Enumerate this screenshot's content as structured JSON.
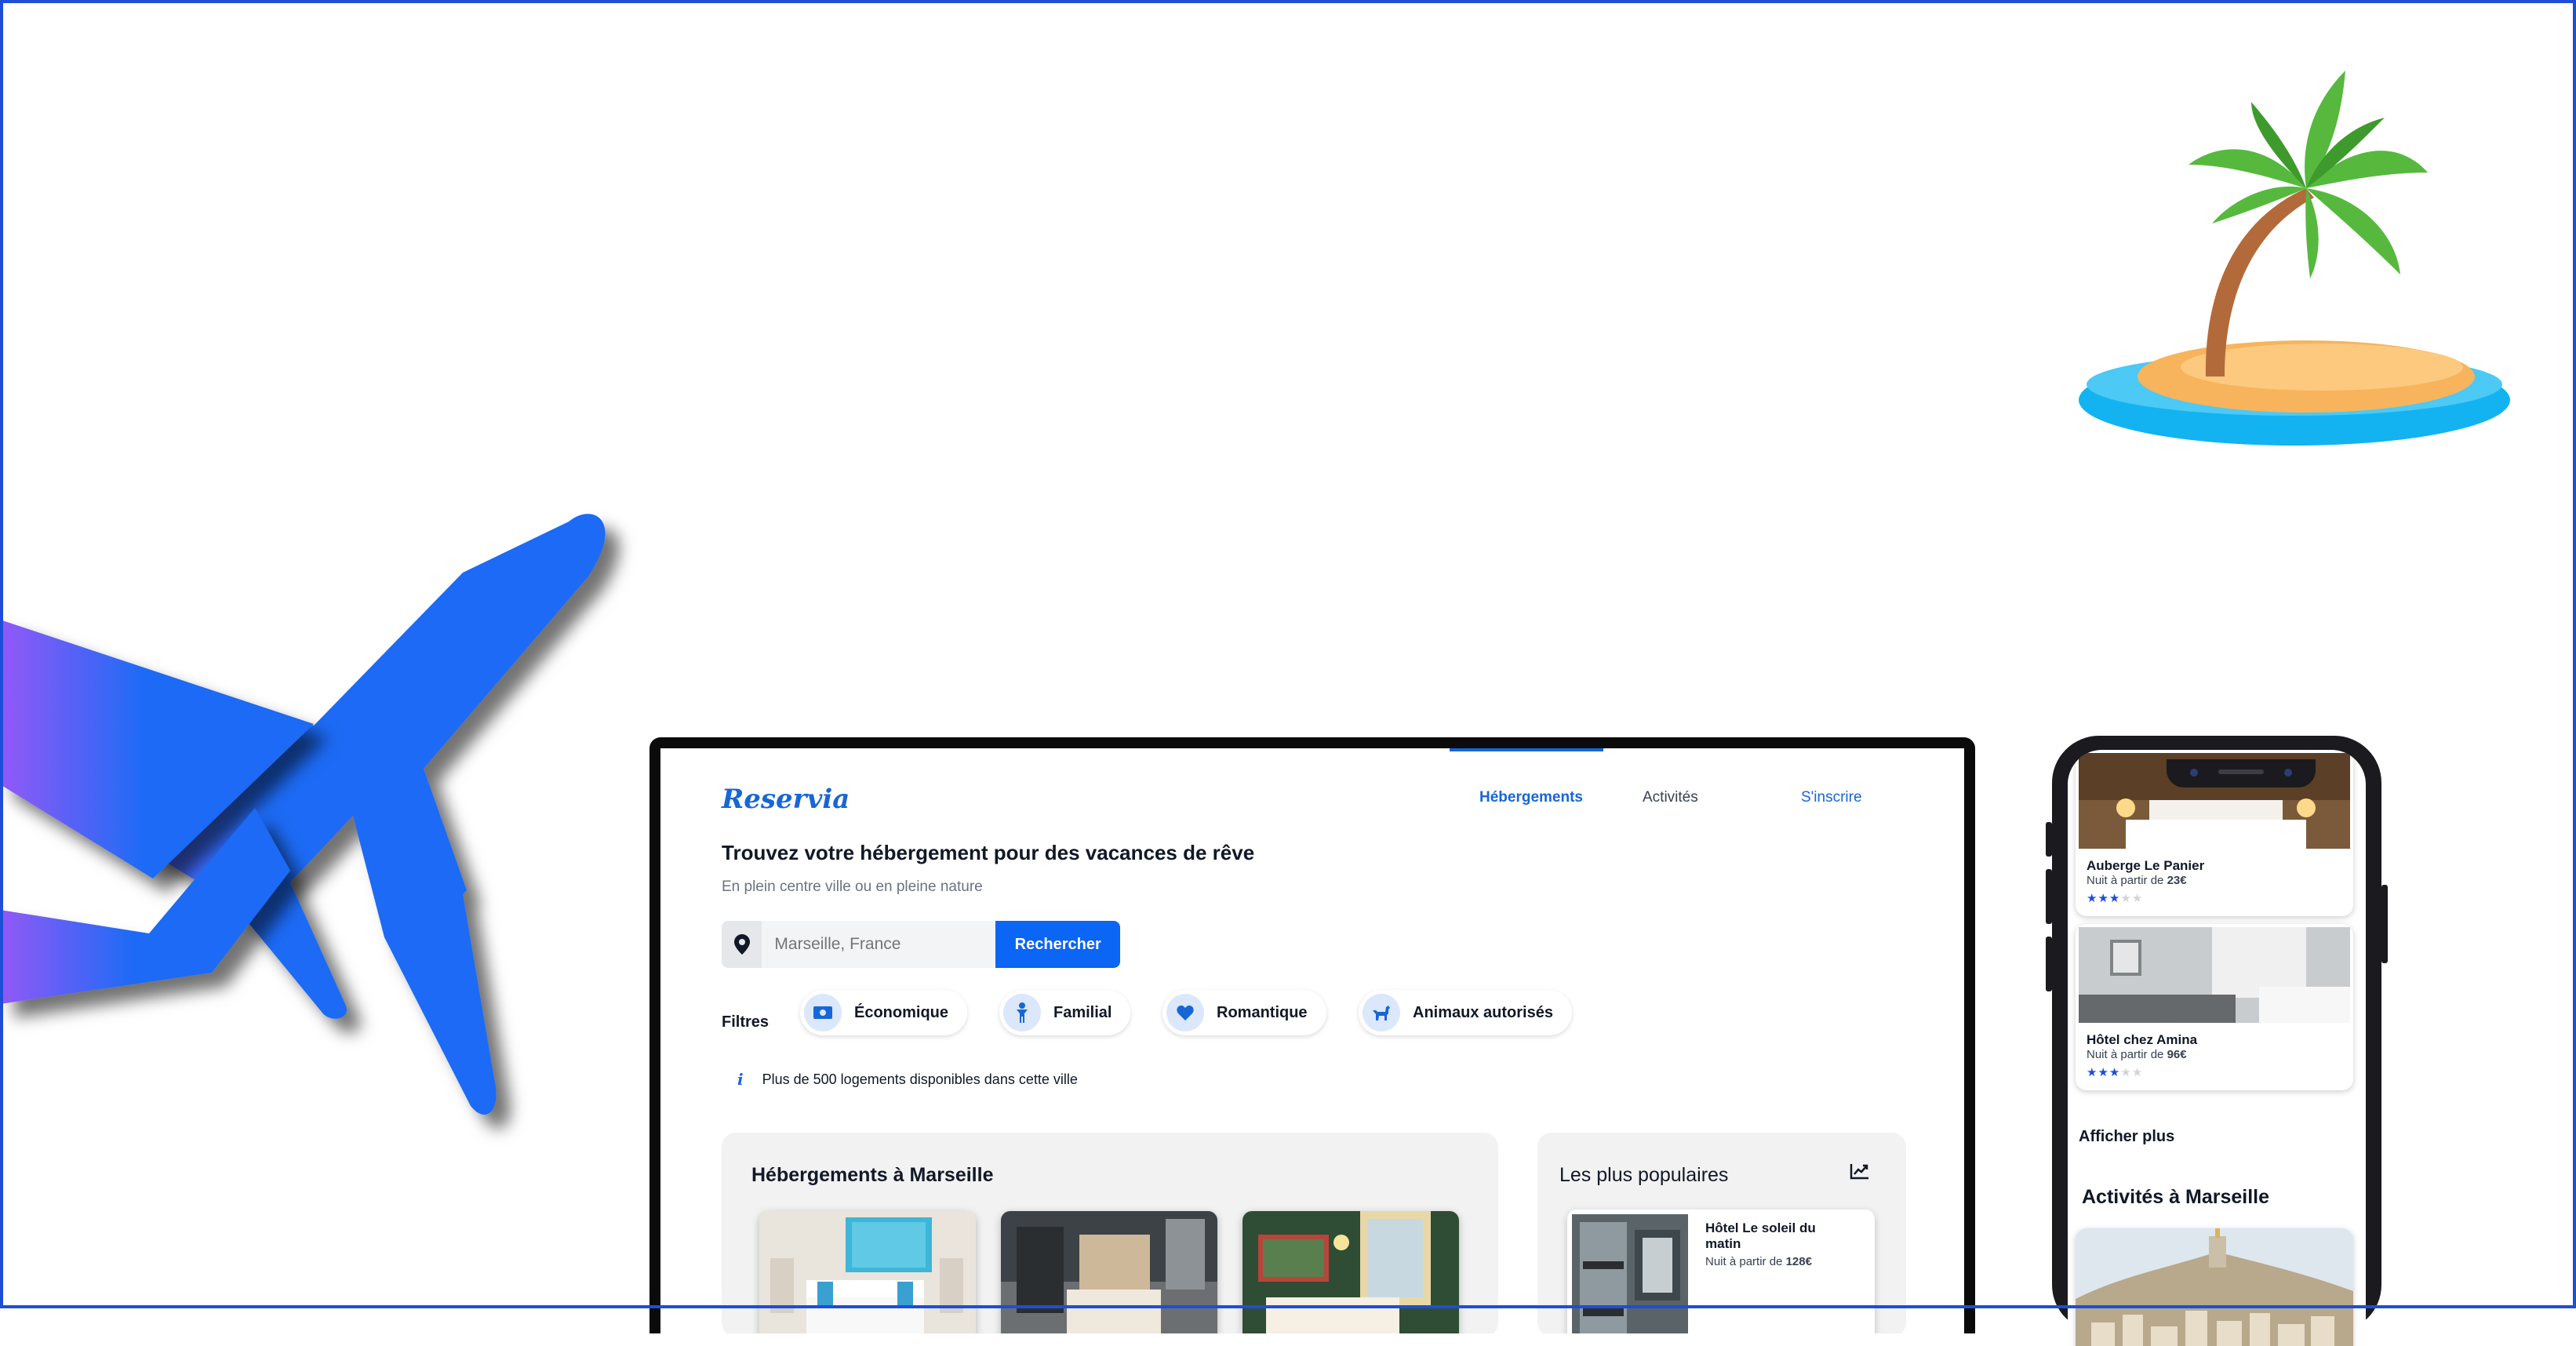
{
  "site": {
    "brand": "Reservia",
    "nav": {
      "accommodations": "Hébergements",
      "activities": "Activités",
      "signup": "S'inscrire"
    }
  },
  "hero": {
    "title": "Trouvez votre hébergement pour des vacances de rêve",
    "subtitle": "En plein centre ville ou en pleine nature"
  },
  "search": {
    "placeholder": "Marseille, France",
    "button": "Rechercher"
  },
  "filters": {
    "label": "Filtres",
    "items": [
      {
        "label": "Économique",
        "icon": "money-icon"
      },
      {
        "label": "Familial",
        "icon": "child-icon"
      },
      {
        "label": "Romantique",
        "icon": "heart-icon"
      },
      {
        "label": "Animaux autorisés",
        "icon": "dog-icon"
      }
    ]
  },
  "info": {
    "icon": "info-icon",
    "text": "Plus de 500 logements disponibles dans cette ville"
  },
  "accommodations_panel": {
    "title": "Hébergements à Marseille"
  },
  "popular_panel": {
    "title": "Les plus populaires",
    "icon": "trend-chart-icon",
    "card": {
      "name": "Hôtel Le soleil du matin",
      "price_prefix": "Nuit à partir de",
      "price": "128€"
    }
  },
  "mobile": {
    "cards": [
      {
        "name": "Auberge Le Panier",
        "price_prefix": "Nuit à partir de",
        "price": "23€",
        "rating": 3,
        "rating_max": 5
      },
      {
        "name": "Hôtel chez Amina",
        "price_prefix": "Nuit à partir de",
        "price": "96€",
        "rating": 3,
        "rating_max": 5
      }
    ],
    "show_more": "Afficher plus",
    "activities_title": "Activités à Marseille"
  },
  "colors": {
    "primary": "#0b65f5",
    "brand": "#1766d6",
    "panel_bg": "#f2f2f2",
    "filter_icon_bg": "#dbe7fb",
    "plane_gradient": [
      "#9358f7",
      "#1f6bf5"
    ]
  }
}
